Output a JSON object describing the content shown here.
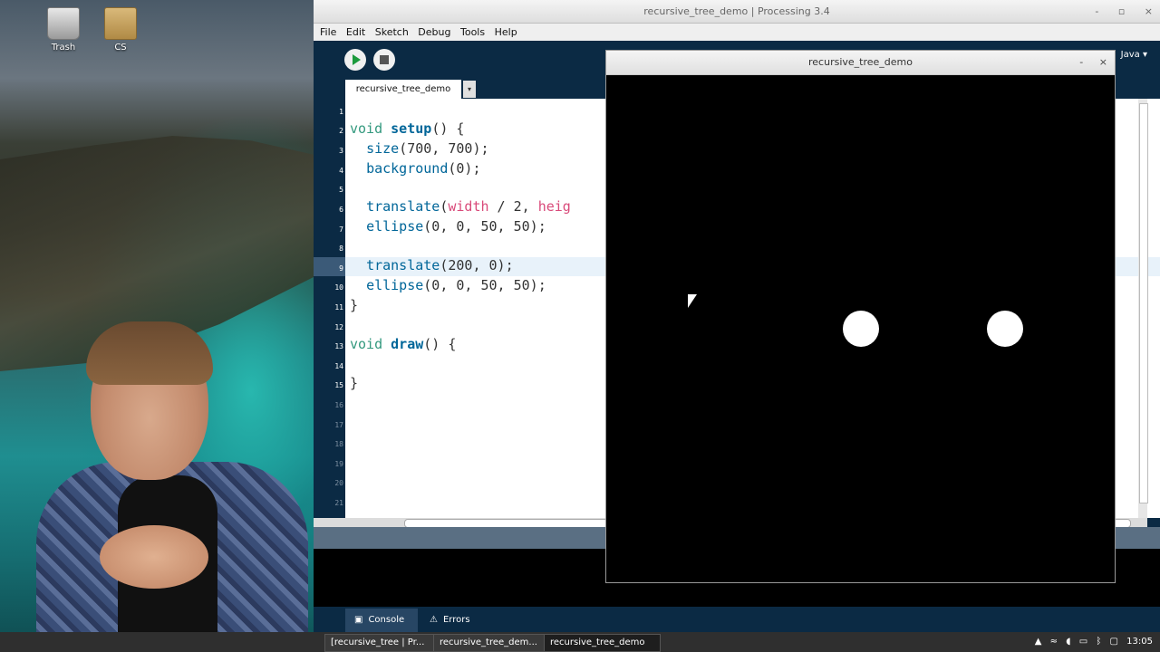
{
  "desktop": {
    "icons": [
      {
        "label": "Trash",
        "icon": "trash-icon"
      },
      {
        "label": "CS",
        "icon": "folder-icon"
      }
    ]
  },
  "ide": {
    "window_title": "recursive_tree_demo | Processing 3.4",
    "window_controls": [
      "-",
      "▫",
      "×"
    ],
    "menu": [
      "File",
      "Edit",
      "Sketch",
      "Debug",
      "Tools",
      "Help"
    ],
    "mode": "Java ▾",
    "tab_label": "recursive_tree_demo",
    "tab_arrow": "▾",
    "line_numbers": [
      "1",
      "2",
      "3",
      "4",
      "5",
      "6",
      "7",
      "8",
      "9",
      "10",
      "11",
      "12",
      "13",
      "14",
      "15",
      "16",
      "17",
      "18",
      "19",
      "20",
      "21"
    ],
    "code": {
      "l2a": "void ",
      "l2b": "setup",
      "l2c": "() {",
      "l3a": "  ",
      "l3b": "size",
      "l3c": "(700, 700);",
      "l4a": "  ",
      "l4b": "background",
      "l4c": "(0);",
      "l6a": "  ",
      "l6b": "translate",
      "l6c": "(",
      "l6d": "width",
      "l6e": " / 2, ",
      "l6f": "heig",
      "l7a": "  ",
      "l7b": "ellipse",
      "l7c": "(0, 0, 50, 50);",
      "l9a": "  ",
      "l9b": "translate",
      "l9c": "(200, 0);",
      "l10a": "  ",
      "l10b": "ellipse",
      "l10c": "(0, 0, 50, 50);",
      "l11": "}",
      "l13a": "void ",
      "l13b": "draw",
      "l13c": "() {",
      "l15": "}"
    },
    "console_tabs": [
      {
        "label": "Console",
        "icon": "console-icon"
      },
      {
        "label": "Errors",
        "icon": "warning-icon"
      }
    ]
  },
  "sketch": {
    "title": "recursive_tree_demo",
    "controls": [
      "-",
      "×"
    ]
  },
  "taskbar": {
    "tasks": [
      "[recursive_tree | Pr...",
      "recursive_tree_dem...",
      "recursive_tree_demo"
    ],
    "clock": "13:05"
  }
}
